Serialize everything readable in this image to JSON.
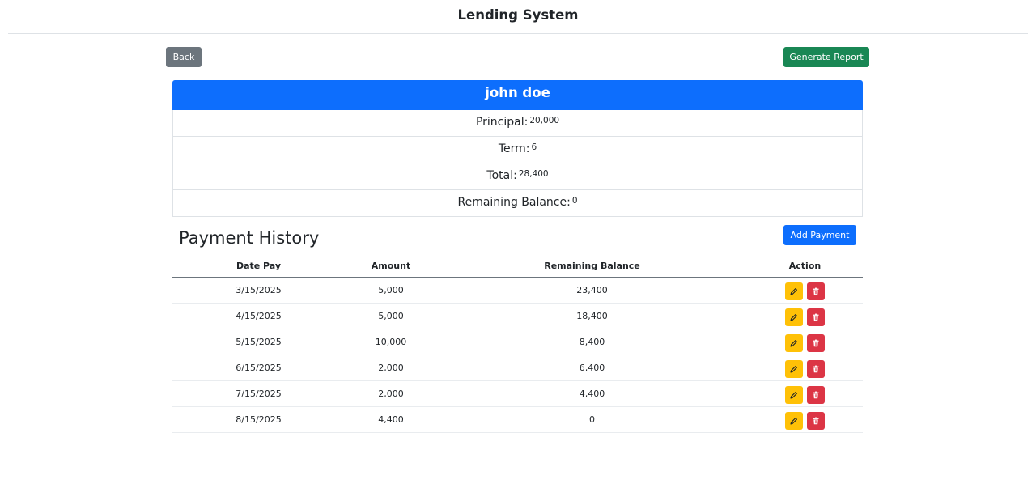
{
  "app": {
    "title": "Lending System"
  },
  "toolbar": {
    "back_label": "Back",
    "report_label": "Generate Report"
  },
  "borrower": {
    "name": "john doe",
    "principal_label": "Principal:",
    "principal_value": "20,000",
    "term_label": "Term:",
    "term_value": "6",
    "total_label": "Total:",
    "total_value": "28,400",
    "balance_label": "Remaining Balance:",
    "balance_value": "0"
  },
  "payments": {
    "title": "Payment History",
    "add_label": "Add Payment",
    "columns": [
      "Date Pay",
      "Amount",
      "Remaining Balance",
      "Action"
    ],
    "rows": [
      {
        "date": "3/15/2025",
        "amount": "5,000",
        "balance": "23,400"
      },
      {
        "date": "4/15/2025",
        "amount": "5,000",
        "balance": "18,400"
      },
      {
        "date": "5/15/2025",
        "amount": "10,000",
        "balance": "8,400"
      },
      {
        "date": "6/15/2025",
        "amount": "2,000",
        "balance": "6,400"
      },
      {
        "date": "7/15/2025",
        "amount": "2,000",
        "balance": "4,400"
      },
      {
        "date": "8/15/2025",
        "amount": "4,400",
        "balance": "0"
      }
    ]
  },
  "icons": {
    "edit": "pencil-icon",
    "delete": "trash-icon"
  },
  "colors": {
    "primary": "#0d6efd",
    "success": "#198754",
    "secondary": "#6c757d",
    "warning": "#ffc107",
    "danger": "#dc3545"
  }
}
